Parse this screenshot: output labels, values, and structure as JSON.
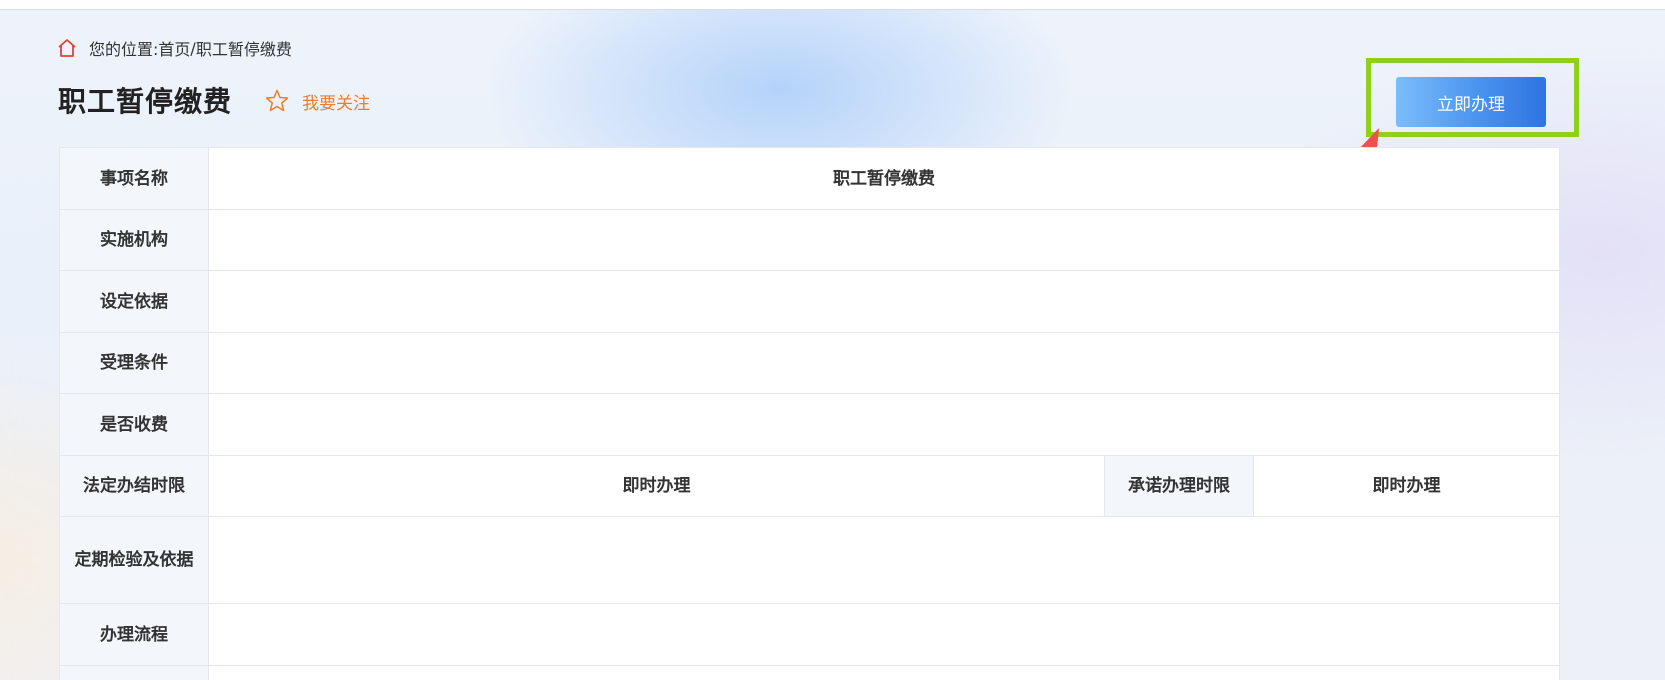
{
  "breadcrumb": {
    "prefix": "您的位置: ",
    "home": "首页",
    "separator": "/ ",
    "current": "职工暂停缴费"
  },
  "title": "职工暂停缴费",
  "follow_label": "我要关注",
  "apply_button": "立即办理",
  "colors": {
    "follow": "#f07b2a",
    "highlight": "#8fd11a",
    "arrow": "#ef4f4f",
    "button": "#4a93ef"
  },
  "table": {
    "rows": [
      {
        "label": "事项名称",
        "value": "职工暂停缴费"
      },
      {
        "label": "实施机构",
        "value": ""
      },
      {
        "label": "设定依据",
        "value": ""
      },
      {
        "label": "受理条件",
        "value": ""
      },
      {
        "label": "是否收费",
        "value": ""
      },
      {
        "label": "法定办结时限",
        "value": "即时办理",
        "label2": "承诺办理时限",
        "value2": "即时办理"
      },
      {
        "label": "定期检验及依据",
        "value": ""
      },
      {
        "label": "办理流程",
        "value": ""
      },
      {
        "label": "",
        "value": ""
      }
    ]
  }
}
